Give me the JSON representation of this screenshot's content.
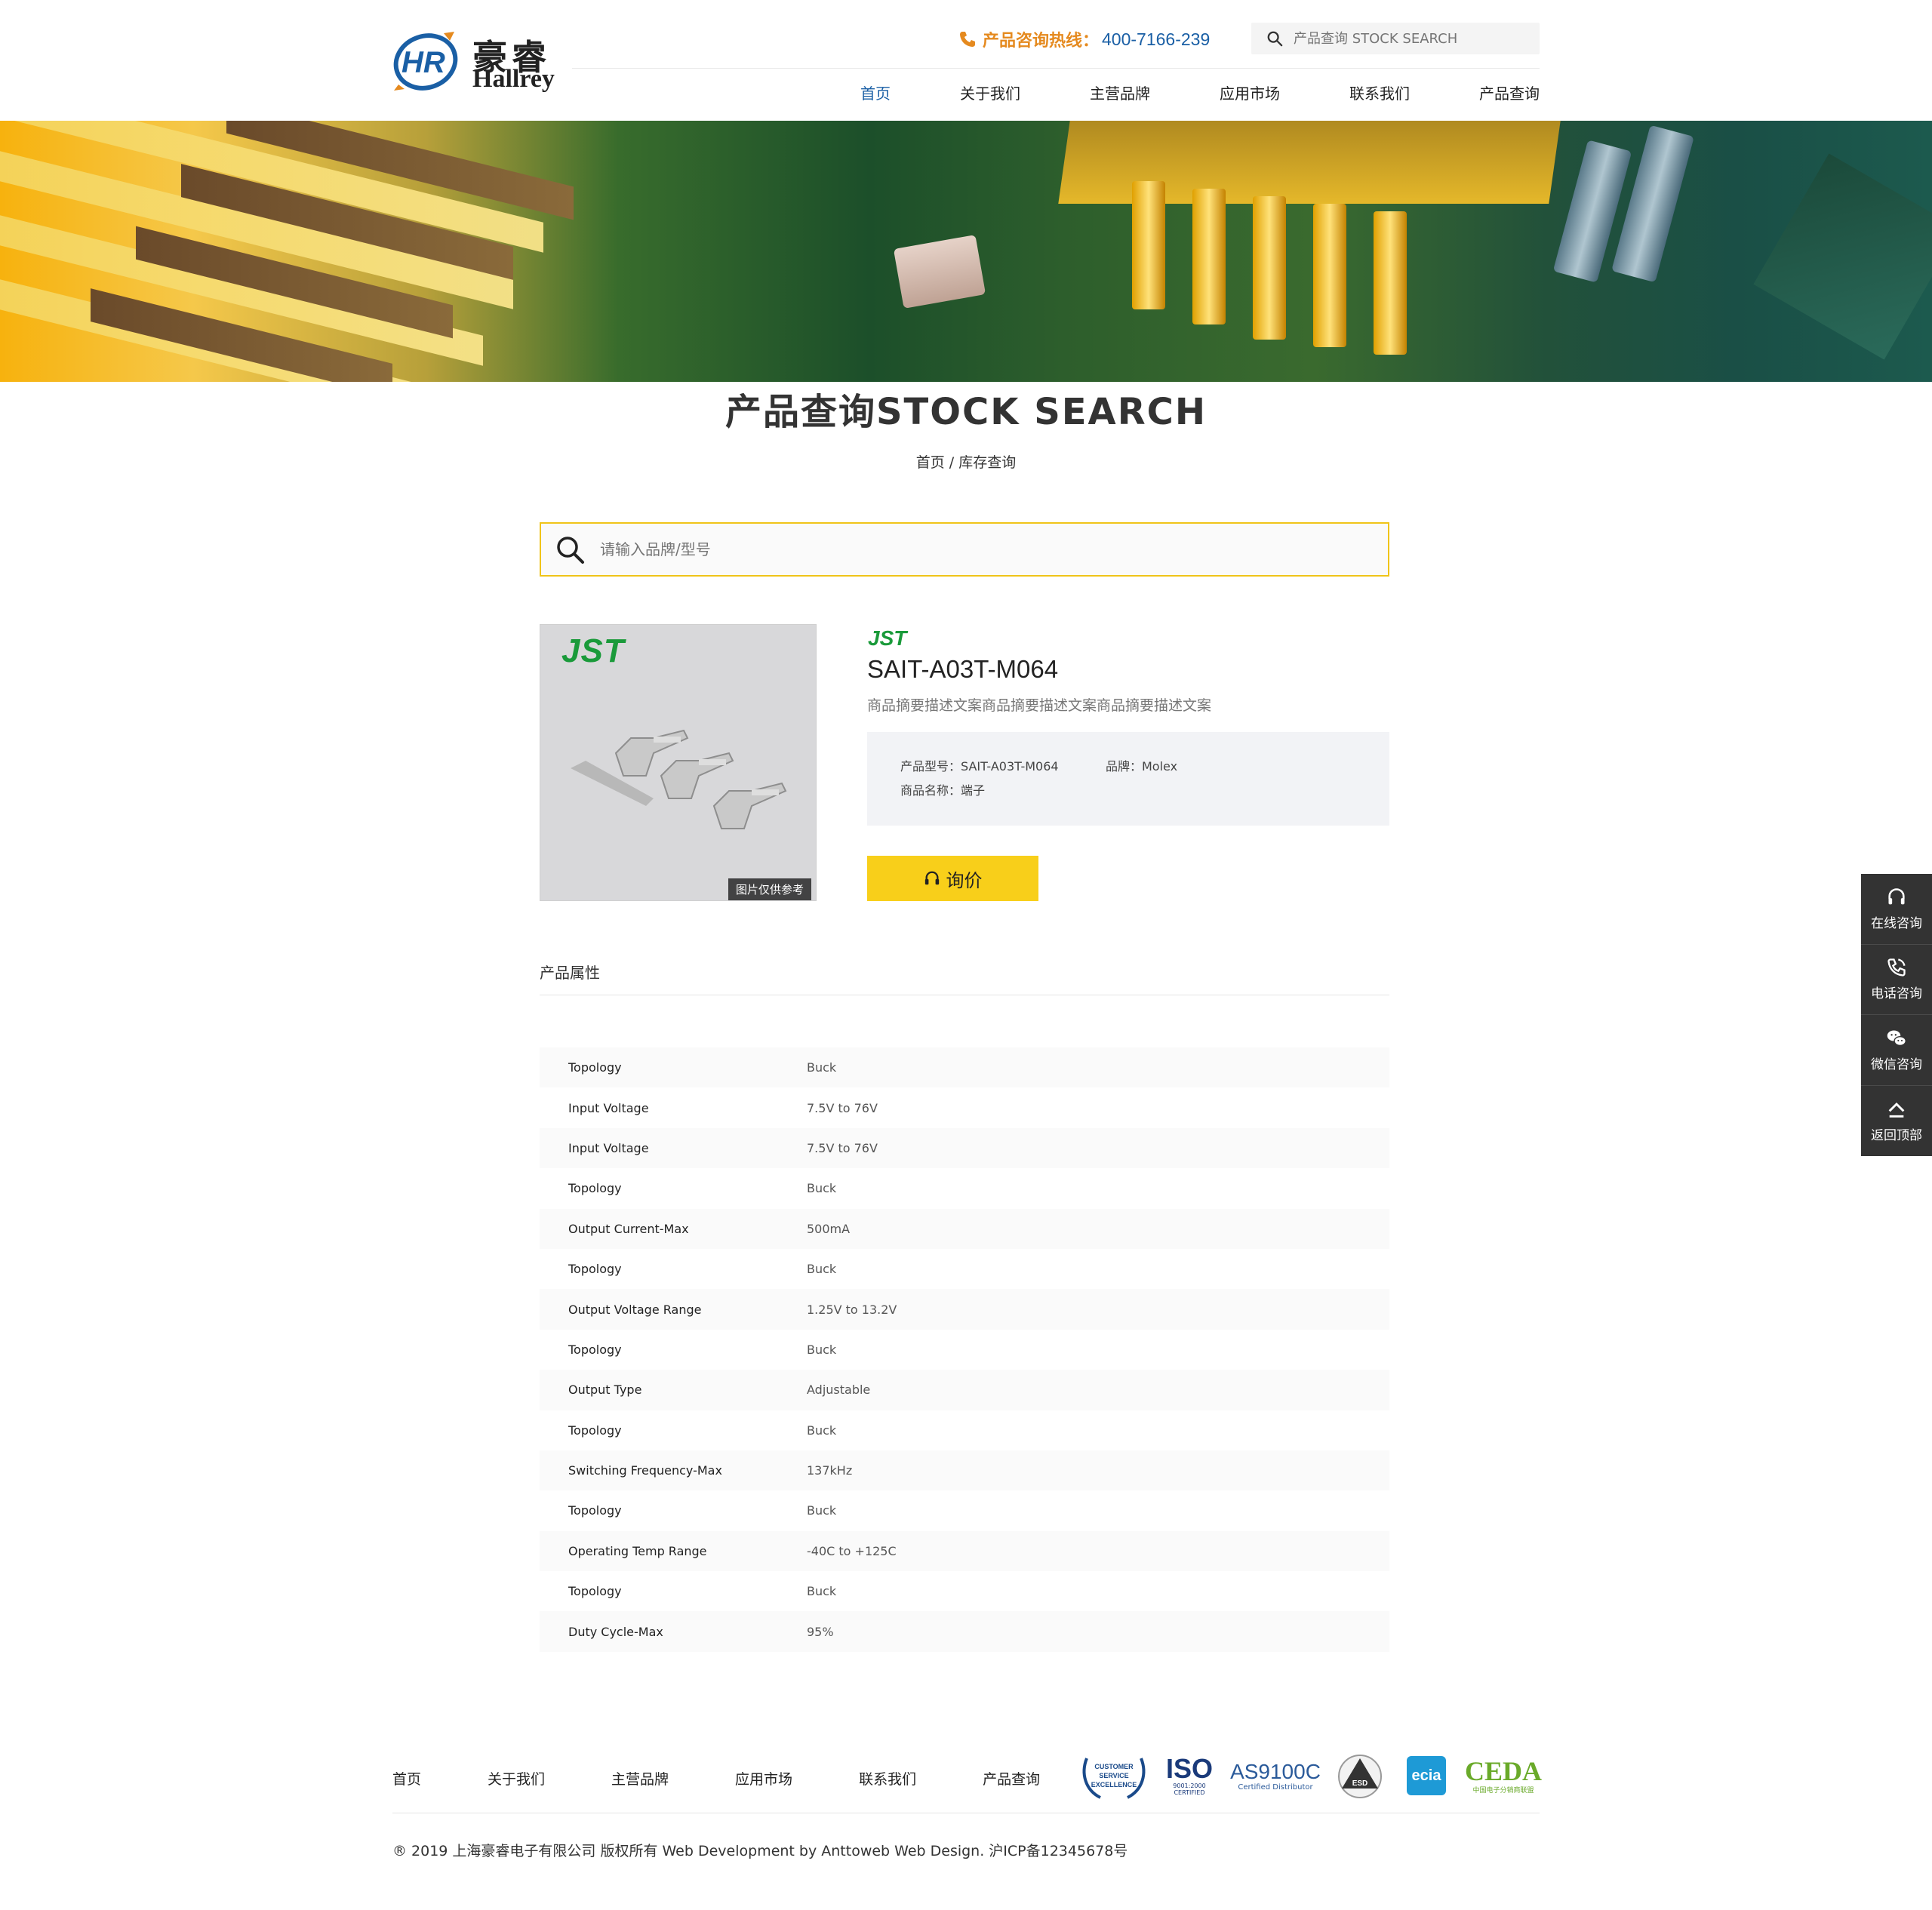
{
  "brand": {
    "name_cn": "豪睿",
    "name_en": "Hallrey",
    "mark": "HR"
  },
  "header": {
    "hotline_label": "产品咨询热线：",
    "hotline_number": "400-7166-239",
    "search_placeholder": "产品查询 STOCK SEARCH"
  },
  "nav": {
    "items": [
      "首页",
      "关于我们",
      "主营品牌",
      "应用市场",
      "联系我们",
      "产品查询"
    ],
    "active_index": 0
  },
  "page": {
    "title": "产品查询STOCK SEARCH",
    "breadcrumb": "首页 / 库存查询"
  },
  "main_search": {
    "placeholder": "请输入品牌/型号"
  },
  "product": {
    "brand_logo": "JST",
    "image_note": "图片仅供参考",
    "name": "SAIT-A03T-M064",
    "summary": "商品摘要描述文案商品摘要描述文案商品摘要描述文案",
    "model_label": "产品型号：SAIT-A03T-M064",
    "brand_label": "品牌：Molex",
    "category_label": "商品名称：端子",
    "inquiry_label": "询价"
  },
  "attributes": {
    "title": "产品属性",
    "rows": [
      {
        "key": "Topology",
        "value": "Buck"
      },
      {
        "key": "Input Voltage",
        "value": "7.5V to 76V"
      },
      {
        "key": "Input Voltage",
        "value": "7.5V to 76V"
      },
      {
        "key": "Topology",
        "value": "Buck"
      },
      {
        "key": "Output Current-Max",
        "value": "500mA"
      },
      {
        "key": "Topology",
        "value": "Buck"
      },
      {
        "key": "Output Voltage Range",
        "value": "1.25V to 13.2V"
      },
      {
        "key": "Topology",
        "value": "Buck"
      },
      {
        "key": "Output Type",
        "value": "Adjustable"
      },
      {
        "key": "Topology",
        "value": "Buck"
      },
      {
        "key": "Switching Frequency-Max",
        "value": "137kHz"
      },
      {
        "key": "Topology",
        "value": "Buck"
      },
      {
        "key": "Operating Temp Range",
        "value": "-40C to +125C"
      },
      {
        "key": "Topology",
        "value": "Buck"
      },
      {
        "key": "Duty Cycle-Max",
        "value": "95%"
      }
    ]
  },
  "sidebar": {
    "items": [
      {
        "label": "在线咨询",
        "icon": "headset-icon"
      },
      {
        "label": "电话咨询",
        "icon": "phone-icon"
      },
      {
        "label": "微信咨询",
        "icon": "wechat-icon"
      },
      {
        "label": "返回顶部",
        "icon": "back-to-top-icon"
      }
    ]
  },
  "footer": {
    "nav": [
      "首页",
      "关于我们",
      "主营品牌",
      "应用市场",
      "联系我们",
      "产品查询"
    ],
    "certs": {
      "cse": [
        "CUSTOMER",
        "SERVICE",
        "EXCELLENCE"
      ],
      "iso": "ISO",
      "iso_sub": "9001:2000",
      "iso_sub2": "CERTIFIED",
      "as": "AS9100C",
      "as_sub": "Certified Distributor",
      "esd": "ESD",
      "ecia": "ecia",
      "ceda": "CEDA",
      "ceda_sub": "中国电子分销商联盟"
    },
    "copyright": "® 2019 上海豪睿电子有限公司 版权所有 Web Development by Anttoweb Web Design. 沪ICP备12345678号"
  },
  "colors": {
    "accent_blue": "#1a5fa5",
    "accent_orange": "#e58a1f",
    "button_yellow": "#f8cf1a",
    "search_border": "#f0c419",
    "sidebar_bg": "#333333",
    "jst_green": "#1a9a3a"
  }
}
